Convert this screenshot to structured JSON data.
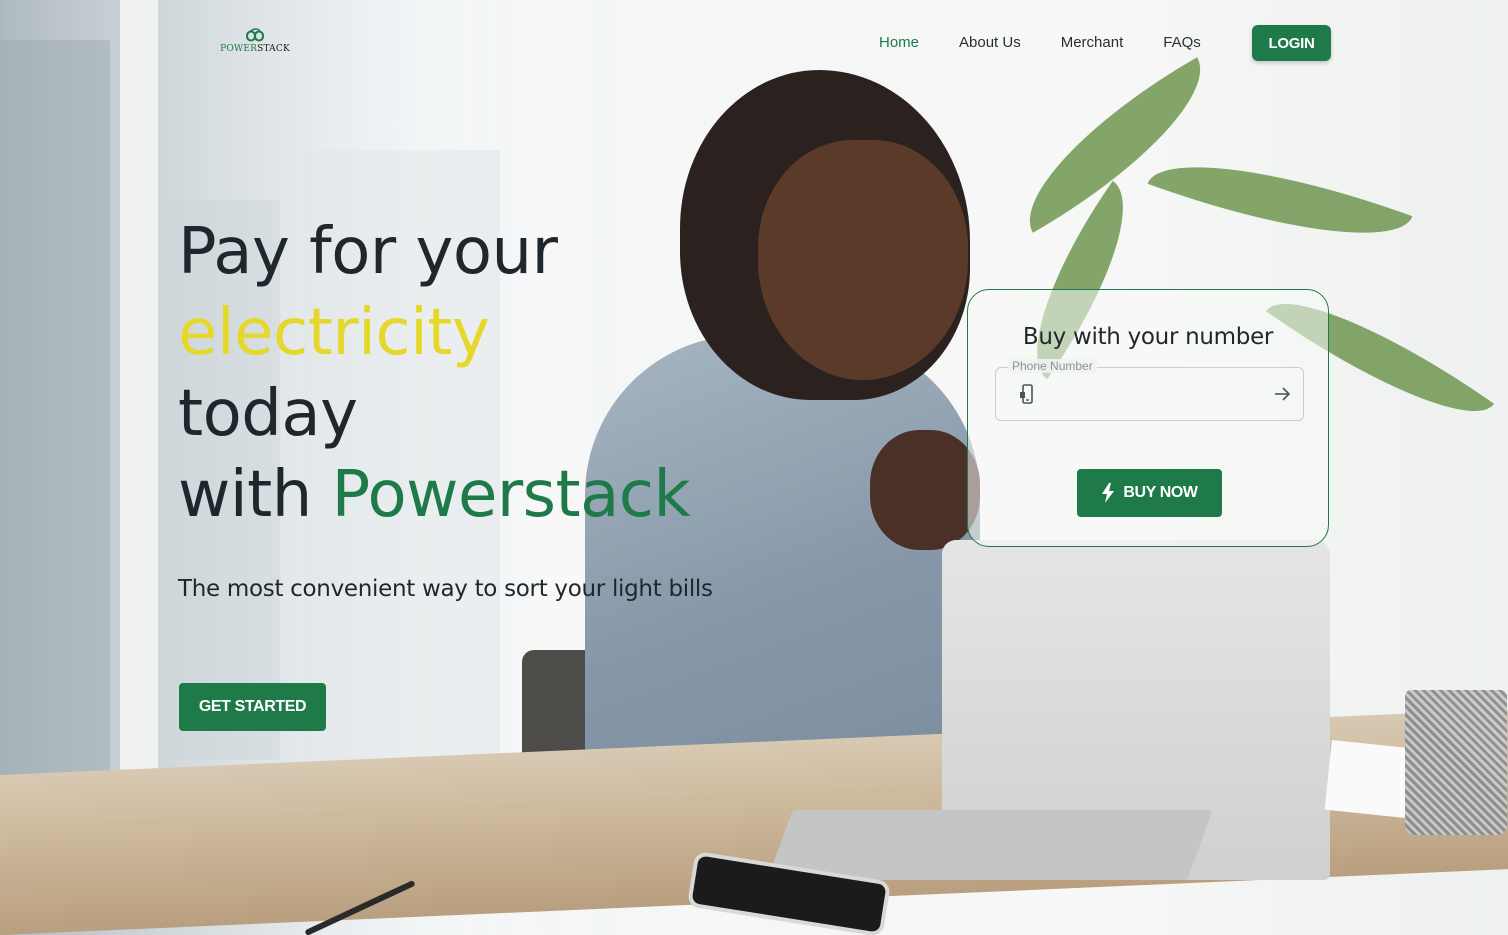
{
  "brand": {
    "logo_text_power": "POWER",
    "logo_text_stack": "STACK",
    "primary_color": "#1e7a48",
    "highlight_color": "#e5d82a"
  },
  "nav": {
    "items": [
      {
        "label": "Home",
        "active": true
      },
      {
        "label": "About Us",
        "active": false
      },
      {
        "label": "Merchant",
        "active": false
      },
      {
        "label": "FAQs",
        "active": false
      }
    ],
    "login_label": "LOGIN"
  },
  "hero": {
    "headline": {
      "line1": "Pay for your",
      "line2": "electricity",
      "line3": "today",
      "line4_prefix": "with ",
      "line4_brand": "Powerstack"
    },
    "subtitle": "The most convenient way to sort your light bills",
    "cta_label": "GET STARTED"
  },
  "buy_card": {
    "title": "Buy with your number",
    "phone_label": "Phone Number",
    "phone_value": "",
    "buy_label": "BUY NOW",
    "icons": [
      "phone-icon",
      "arrow-right-icon",
      "lightning-icon"
    ]
  }
}
